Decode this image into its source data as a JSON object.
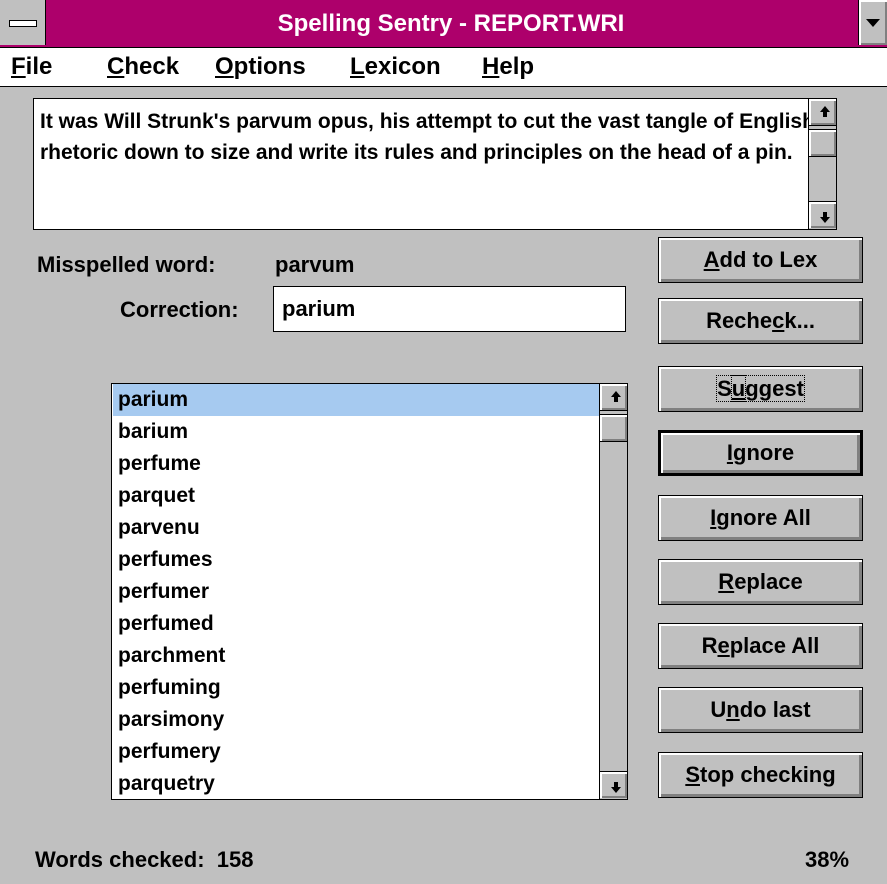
{
  "window": {
    "title": "Spelling Sentry - REPORT.WRI"
  },
  "menu": {
    "file": "File",
    "check": "Check",
    "options": "Options",
    "lexicon": "Lexicon",
    "help": "Help"
  },
  "context": {
    "text": "It was Will Strunk's parvum opus, his attempt to cut the vast tangle of English rhetoric down to size and write its rules and principles on the head of a pin."
  },
  "misspelled": {
    "label": "Misspelled word:",
    "word": "parvum"
  },
  "correction": {
    "label": "Correction:",
    "value": "parium"
  },
  "suggestions": {
    "selected_index": 0,
    "items": [
      "parium",
      "barium",
      "perfume",
      "parquet",
      "parvenu",
      "perfumes",
      "perfumer",
      "perfumed",
      "parchment",
      "perfuming",
      "parsimony",
      "perfumery",
      "parquetry"
    ]
  },
  "buttons": {
    "add_to_lex": "Add to Lex",
    "recheck": "Recheck...",
    "suggest": "Suggest",
    "ignore": "Ignore",
    "ignore_all": "Ignore All",
    "replace": "Replace",
    "replace_all": "Replace All",
    "undo_last": "Undo last",
    "stop_checking": "Stop checking"
  },
  "status": {
    "words_checked_label": "Words checked:",
    "words_checked": "158",
    "percent": "38%"
  },
  "colors": {
    "titlebar": "#ad006b",
    "selection": "#a6caf0",
    "face": "#c0c0c0"
  }
}
